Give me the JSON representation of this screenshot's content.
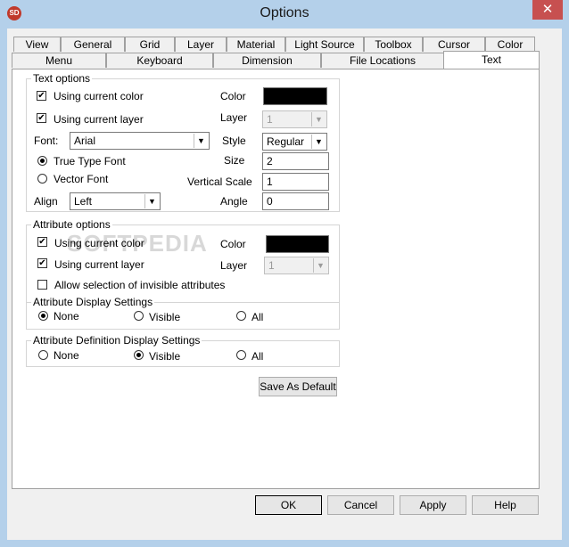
{
  "window": {
    "title": "Options",
    "close": "✕",
    "app_icon": "SD"
  },
  "tabs_row1": [
    "View",
    "General",
    "Grid",
    "Layer",
    "Material",
    "Light Source",
    "Toolbox",
    "Cursor",
    "Color"
  ],
  "tabs_row2": [
    "Menu",
    "Keyboard",
    "Dimension",
    "File Locations",
    "Text"
  ],
  "active_tab": "Text",
  "text_options": {
    "label": "Text options",
    "use_color_label": "Using current color",
    "use_color_checked": true,
    "color_label": "Color",
    "color_value": "#000000",
    "use_layer_label": "Using current layer",
    "use_layer_checked": true,
    "layer_label": "Layer",
    "layer_value": "1",
    "font_label": "Font:",
    "font_value": "Arial",
    "style_label": "Style",
    "style_value": "Regular",
    "truetype_label": "True Type Font",
    "vector_label": "Vector Font",
    "size_label": "Size",
    "size_value": "2",
    "vscale_label": "Vertical Scale",
    "vscale_value": "1",
    "align_label": "Align",
    "align_value": "Left",
    "angle_label": "Angle",
    "angle_value": "0"
  },
  "attribute_options": {
    "label": "Attribute options",
    "use_color_label": "Using current color",
    "color_label": "Color",
    "color_value": "#000000",
    "use_layer_label": "Using current layer",
    "layer_label": "Layer",
    "layer_value": "1",
    "invisible_label": "Allow selection of invisible attributes"
  },
  "attr_display": {
    "label": "Attribute Display Settings",
    "none": "None",
    "visible": "Visible",
    "all": "All",
    "selected": "None"
  },
  "attr_def_display": {
    "label": "Attribute Definition Display Settings",
    "none": "None",
    "visible": "Visible",
    "all": "All",
    "selected": "Visible"
  },
  "save_default": "Save As Default",
  "buttons": {
    "ok": "OK",
    "cancel": "Cancel",
    "apply": "Apply",
    "help": "Help"
  },
  "watermark": "SOFTPEDIA"
}
